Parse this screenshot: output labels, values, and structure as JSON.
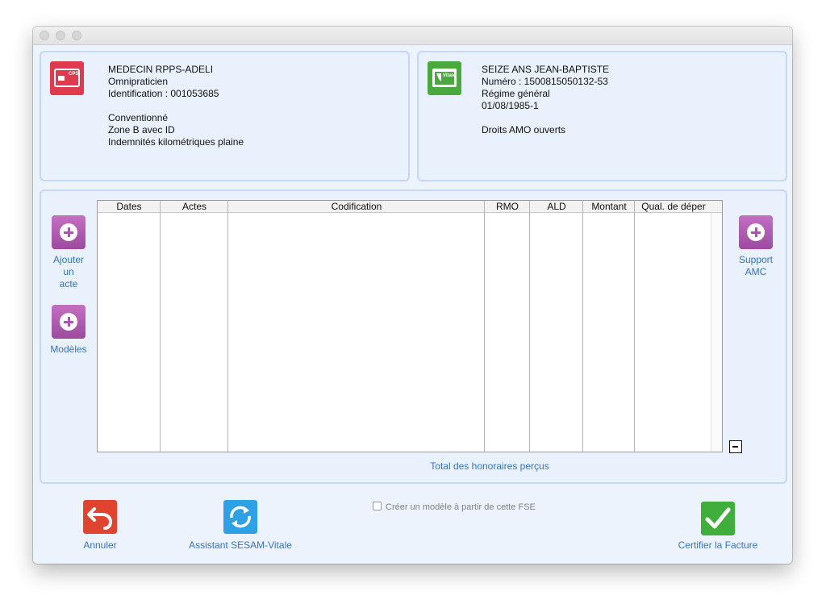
{
  "window": {
    "title": ""
  },
  "doctor_card": {
    "icon": "cps-card-icon",
    "icon_text": "CPS",
    "color": "#e03a4e",
    "name": "MEDECIN RPPS-ADELI",
    "specialty": "Omnipraticien",
    "identification": "Identification : 001053685",
    "convention": "Conventionné",
    "zone": "Zone B avec ID",
    "indemnities": "Indemnités kilométriques plaine"
  },
  "patient_card": {
    "icon": "vitale-card-icon",
    "icon_text": "Vitale",
    "color": "#4aa83f",
    "name": "SEIZE ANS JEAN-BAPTISTE",
    "number": "Numéro : 1500815050132-53",
    "regime": "Régime général",
    "birth": "01/08/1985-1",
    "rights": "Droits AMO ouverts"
  },
  "acts": {
    "add_act_label_1": "Ajouter",
    "add_act_label_2": "un",
    "add_act_label_3": "acte",
    "models_label": "Modèles",
    "support_label_1": "Support",
    "support_label_2": "AMC",
    "columns": [
      "Dates",
      "Actes",
      "Codification",
      "RMO",
      "ALD",
      "Montant",
      "Qual. de déper"
    ],
    "rows": [],
    "total_label": "Total des honoraires perçus"
  },
  "footer": {
    "cancel_label": "Annuler",
    "assistant_label": "Assistant SESAM-Vitale",
    "create_model_label": "Créer un modèle à partir de cette FSE",
    "create_model_checked": false,
    "certify_label": "Certifier la Facture"
  },
  "colors": {
    "accent_text": "#3574b8",
    "panel_border": "#c2d8f6",
    "purple_button": "#a955a9",
    "cancel_red": "#e0442e",
    "assistant_blue": "#2ea0e6",
    "certify_green": "#3fae3a"
  }
}
